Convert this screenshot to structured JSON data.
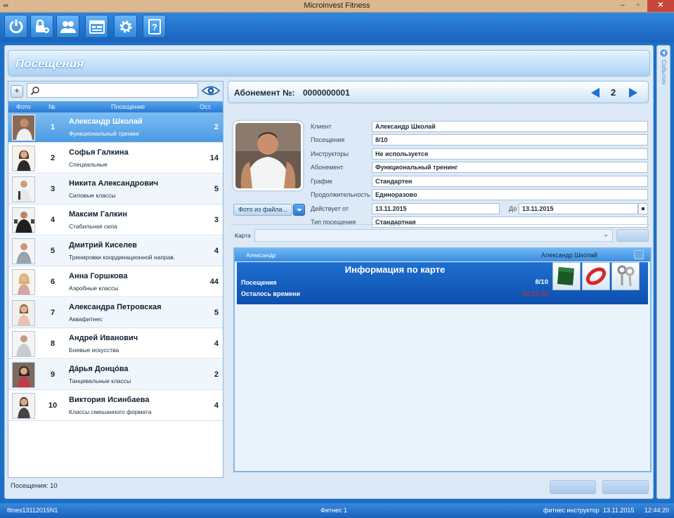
{
  "window": {
    "title": "Microinvest Fitness",
    "minimize": "–",
    "maximize": "▫",
    "close": "✕"
  },
  "page_title": "Посещения",
  "search": {
    "value": "",
    "placeholder": ""
  },
  "list": {
    "headers": {
      "photo": "Фото",
      "num": "№",
      "visit": "Посещение",
      "rest": "Ост."
    },
    "rows": [
      {
        "num": "1",
        "name": "Александр Школай",
        "sub": "Функциональный тренинг",
        "count": "2",
        "selected": true
      },
      {
        "num": "2",
        "name": "Софья Галкина",
        "sub": "Специальные",
        "count": "14"
      },
      {
        "num": "3",
        "name": "Никита Александрович",
        "sub": "Силовые классы",
        "count": "5"
      },
      {
        "num": "4",
        "name": "Максим Галкин",
        "sub": "Стабильная сила",
        "count": "3"
      },
      {
        "num": "5",
        "name": "Дмитрий Киселев",
        "sub": "Тренировки координационной направ.",
        "count": "4"
      },
      {
        "num": "6",
        "name": "Анна Горшкова",
        "sub": "Аэробные классы",
        "count": "44"
      },
      {
        "num": "7",
        "name": "Александра Петровская",
        "sub": "Аквафитнес",
        "count": "5"
      },
      {
        "num": "8",
        "name": "Андрей Иванович",
        "sub": "Боевые искусства",
        "count": "4"
      },
      {
        "num": "9",
        "name": "Дáрья Донцóва",
        "sub": "Танцевальные классы",
        "count": "2"
      },
      {
        "num": "10",
        "name": "Виктория Исинбаева",
        "sub": "Классы смешанного формата",
        "count": "4"
      }
    ],
    "footer": "Посещения: 10"
  },
  "abonement": {
    "label": "Абонемент №:",
    "number": "0000000001",
    "page": "2"
  },
  "photo_button": "Фото из файла...",
  "fields": {
    "client": {
      "label": "Клиент",
      "value": "Александр Школай"
    },
    "visits": {
      "label": "Посещения",
      "value": "8/10"
    },
    "instructors": {
      "label": "Инструкторы",
      "value": "Не используется"
    },
    "subscription": {
      "label": "Абонемент",
      "value": "Функциональный тренинг"
    },
    "schedule": {
      "label": "График",
      "value": "Стандартен"
    },
    "duration": {
      "label": "Продолжительность",
      "value": "Единоразово"
    },
    "valid_from": {
      "label": "Действует от",
      "value": "13.11.2015"
    },
    "valid_to": {
      "label": "До",
      "value": "13.11.2015"
    },
    "visit_type": {
      "label": "Тип посещения",
      "value": "Стандартная"
    }
  },
  "card": {
    "label": "Карта",
    "value": ""
  },
  "card_info": {
    "left_name": "Александр",
    "right_name": "Александр Школай",
    "title": "Информация по карте",
    "visits_label": "Посещения",
    "visits_value": "8/10",
    "time_label": "Осталось времени",
    "time_value": "00:25:00"
  },
  "side_panel": "События",
  "status": {
    "left": "fitnes13112015N1",
    "center": "Фитнес 1",
    "user": "фитнес инструктор",
    "date": "13.11.2015",
    "time": "12:44:20"
  },
  "colors": {
    "accent": "#1e6fc4",
    "selected_row": "#5aa6ef",
    "time_red": "#e22a2a"
  }
}
